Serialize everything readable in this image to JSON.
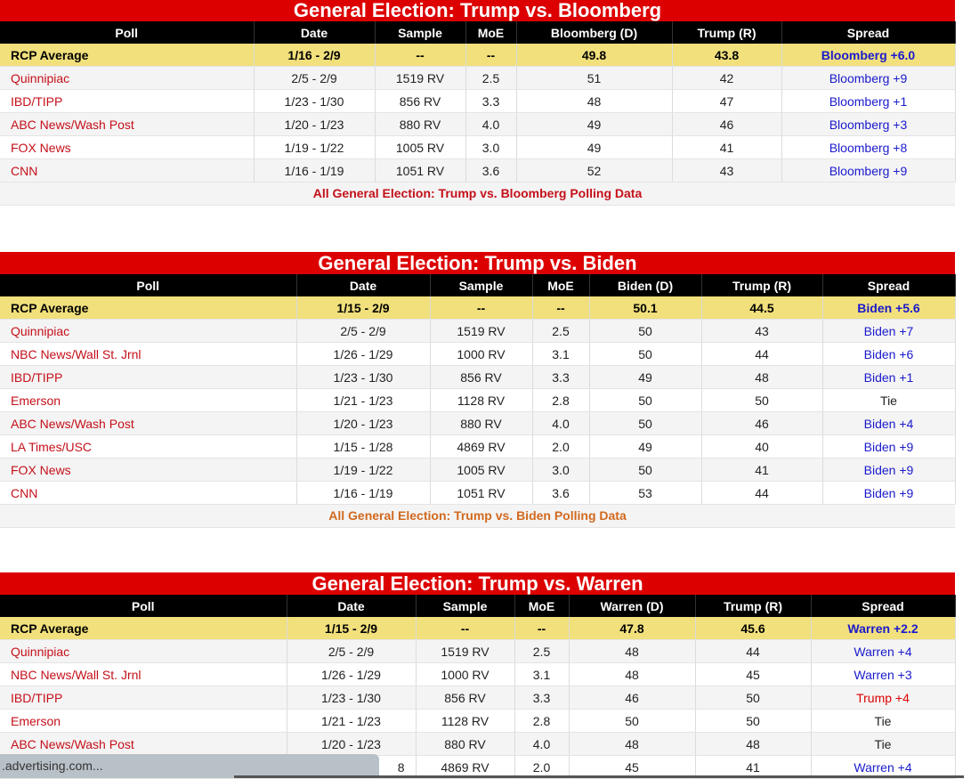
{
  "sections": [
    {
      "title": "General Election: Trump vs. Bloomberg",
      "headers": [
        "Poll",
        "Date",
        "Sample",
        "MoE",
        "Bloomberg (D)",
        "Trump (R)",
        "Spread"
      ],
      "rows": [
        [
          "RCP Average",
          "1/16 - 2/9",
          "--",
          "--",
          "49.8",
          "43.8",
          "Bloomberg +6.0"
        ],
        [
          "Quinnipiac",
          "2/5 - 2/9",
          "1519 RV",
          "2.5",
          "51",
          "42",
          "Bloomberg +9"
        ],
        [
          "IBD/TIPP",
          "1/23 - 1/30",
          "856 RV",
          "3.3",
          "48",
          "47",
          "Bloomberg +1"
        ],
        [
          "ABC News/Wash Post",
          "1/20 - 1/23",
          "880 RV",
          "4.0",
          "49",
          "46",
          "Bloomberg +3"
        ],
        [
          "FOX News",
          "1/19 - 1/22",
          "1005 RV",
          "3.0",
          "49",
          "41",
          "Bloomberg +8"
        ],
        [
          "CNN",
          "1/16 - 1/19",
          "1051 RV",
          "3.6",
          "52",
          "43",
          "Bloomberg +9"
        ]
      ],
      "link": "All General Election: Trump vs. Bloomberg Polling Data"
    },
    {
      "title": "General Election: Trump vs. Biden",
      "headers": [
        "Poll",
        "Date",
        "Sample",
        "MoE",
        "Biden (D)",
        "Trump (R)",
        "Spread"
      ],
      "rows": [
        [
          "RCP Average",
          "1/15 - 2/9",
          "--",
          "--",
          "50.1",
          "44.5",
          "Biden +5.6"
        ],
        [
          "Quinnipiac",
          "2/5 - 2/9",
          "1519 RV",
          "2.5",
          "50",
          "43",
          "Biden +7"
        ],
        [
          "NBC News/Wall St. Jrnl",
          "1/26 - 1/29",
          "1000 RV",
          "3.1",
          "50",
          "44",
          "Biden +6"
        ],
        [
          "IBD/TIPP",
          "1/23 - 1/30",
          "856 RV",
          "3.3",
          "49",
          "48",
          "Biden +1"
        ],
        [
          "Emerson",
          "1/21 - 1/23",
          "1128 RV",
          "2.8",
          "50",
          "50",
          "Tie"
        ],
        [
          "ABC News/Wash Post",
          "1/20 - 1/23",
          "880 RV",
          "4.0",
          "50",
          "46",
          "Biden +4"
        ],
        [
          "LA Times/USC",
          "1/15 - 1/28",
          "4869 RV",
          "2.0",
          "49",
          "40",
          "Biden +9"
        ],
        [
          "FOX News",
          "1/19 - 1/22",
          "1005 RV",
          "3.0",
          "50",
          "41",
          "Biden +9"
        ],
        [
          "CNN",
          "1/16 - 1/19",
          "1051 RV",
          "3.6",
          "53",
          "44",
          "Biden +9"
        ]
      ],
      "link": "All General Election: Trump vs. Biden Polling Data"
    },
    {
      "title": "General Election: Trump vs. Warren",
      "headers": [
        "Poll",
        "Date",
        "Sample",
        "MoE",
        "Warren (D)",
        "Trump (R)",
        "Spread"
      ],
      "rows": [
        [
          "RCP Average",
          "1/15 - 2/9",
          "--",
          "--",
          "47.8",
          "45.6",
          "Warren +2.2"
        ],
        [
          "Quinnipiac",
          "2/5 - 2/9",
          "1519 RV",
          "2.5",
          "48",
          "44",
          "Warren +4"
        ],
        [
          "NBC News/Wall St. Jrnl",
          "1/26 - 1/29",
          "1000 RV",
          "3.1",
          "48",
          "45",
          "Warren +3"
        ],
        [
          "IBD/TIPP",
          "1/23 - 1/30",
          "856 RV",
          "3.3",
          "46",
          "50",
          "Trump +4"
        ],
        [
          "Emerson",
          "1/21 - 1/23",
          "1128 RV",
          "2.8",
          "50",
          "50",
          "Tie"
        ],
        [
          "ABC News/Wash Post",
          "1/20 - 1/23",
          "880 RV",
          "4.0",
          "48",
          "48",
          "Tie"
        ],
        [
          "",
          "",
          "4869 RV",
          "2.0",
          "45",
          "41",
          "Warren +4"
        ]
      ],
      "partial_date": "8"
    }
  ],
  "status_bar": ".advertising.com...",
  "colors": {
    "header_red": "#dd0000",
    "avg_row": "#f1e07c",
    "poll_link": "#c4101a",
    "dem_spread": "#1a1acc",
    "rep_spread": "#dd0000"
  }
}
